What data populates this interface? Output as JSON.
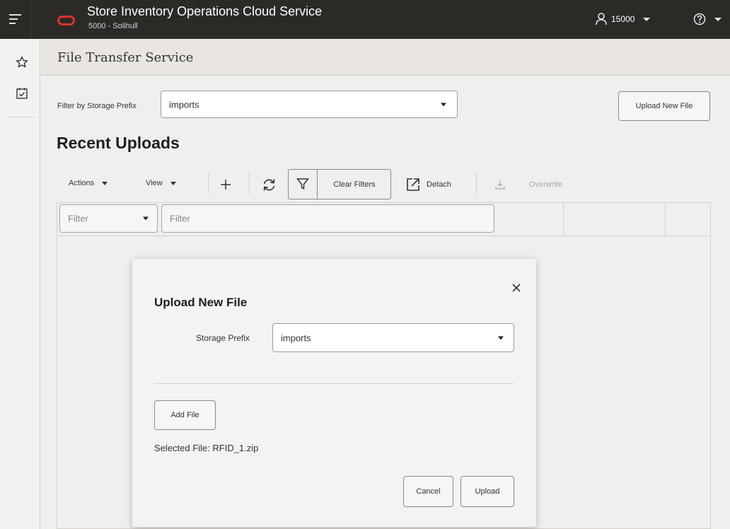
{
  "header": {
    "app_title": "Store Inventory Operations Cloud Service",
    "store_subtitle": "5000 - Solihull",
    "user_id": "15000"
  },
  "page": {
    "title": "File Transfer Service",
    "filter_label": "Filter by Storage Prefix",
    "filter_value": "imports",
    "upload_button": "Upload New File",
    "section_title": "Recent Uploads"
  },
  "toolbar": {
    "actions": "Actions",
    "view": "View",
    "clear_filters": "Clear Filters",
    "detach": "Detach",
    "overwrite": "Overwrite"
  },
  "table": {
    "filter_select_placeholder": "Filter",
    "filter_input_placeholder": "Filter"
  },
  "dialog": {
    "title": "Upload New File",
    "storage_prefix_label": "Storage Prefix",
    "storage_prefix_value": "imports",
    "add_file": "Add File",
    "selected_file": "Selected File: RFID_1.zip",
    "cancel": "Cancel",
    "upload": "Upload"
  },
  "colors": {
    "topbar": "#2c2a27",
    "brand_red": "#d9342b",
    "page_bg": "#f1efed"
  }
}
